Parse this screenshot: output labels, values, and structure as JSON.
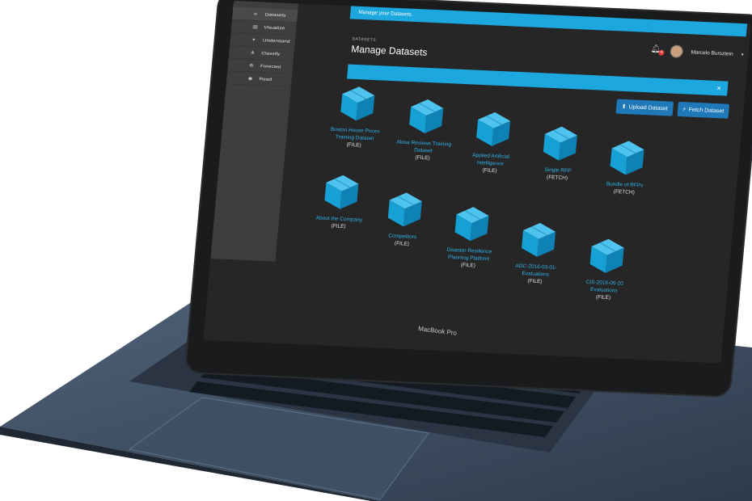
{
  "sidebar": {
    "items": [
      {
        "label": "Datasets",
        "icon": "database-icon",
        "glyph": "≡"
      },
      {
        "label": "Visualize",
        "icon": "bar-chart-icon",
        "glyph": "▥"
      },
      {
        "label": "Understand",
        "icon": "lightbulb-icon",
        "glyph": "✦"
      },
      {
        "label": "Classify",
        "icon": "sitemap-icon",
        "glyph": "⋔"
      },
      {
        "label": "Forecast",
        "icon": "road-icon",
        "glyph": "⟰"
      },
      {
        "label": "Read",
        "icon": "eye-icon",
        "glyph": "◉"
      }
    ]
  },
  "notice": {
    "text": "Manage your Datasets."
  },
  "user": {
    "name": "Marcelo Bursztein",
    "notifications": "4"
  },
  "header": {
    "breadcrumb": "DATASETS",
    "title": "Manage Datasets"
  },
  "alert": {
    "close": "×"
  },
  "actions": {
    "upload": "Upload Dataset",
    "fetch": "Fetch Dataset"
  },
  "datasets": [
    {
      "name": "Boston House Prices Training Dataset",
      "type": "(FILE)"
    },
    {
      "name": "Alexa Reviews Training Dataset",
      "type": "(FILE)"
    },
    {
      "name": "Applied Artificial Intelligence",
      "type": "(FILE)"
    },
    {
      "name": "Single RFP",
      "type": "(FETCH)"
    },
    {
      "name": "Bundle of RFPs",
      "type": "(FETCH)"
    },
    {
      "name": "About the Company",
      "type": "(FILE)"
    },
    {
      "name": "Competitors",
      "type": "(FILE)"
    },
    {
      "name": "Disaster Resilience Planning Platform",
      "type": "(FILE)"
    },
    {
      "name": "ADC-2016-03-01-Evaluations",
      "type": "(FILE)"
    },
    {
      "name": "CIS-2016-06-20 Evaluations",
      "type": "(FILE)"
    }
  ],
  "colors": {
    "accent": "#1da7df",
    "button": "#1f79b9",
    "link": "#2fb3ea",
    "cube": "#1aa3d4"
  },
  "device": {
    "brand": "MacBook Pro"
  }
}
